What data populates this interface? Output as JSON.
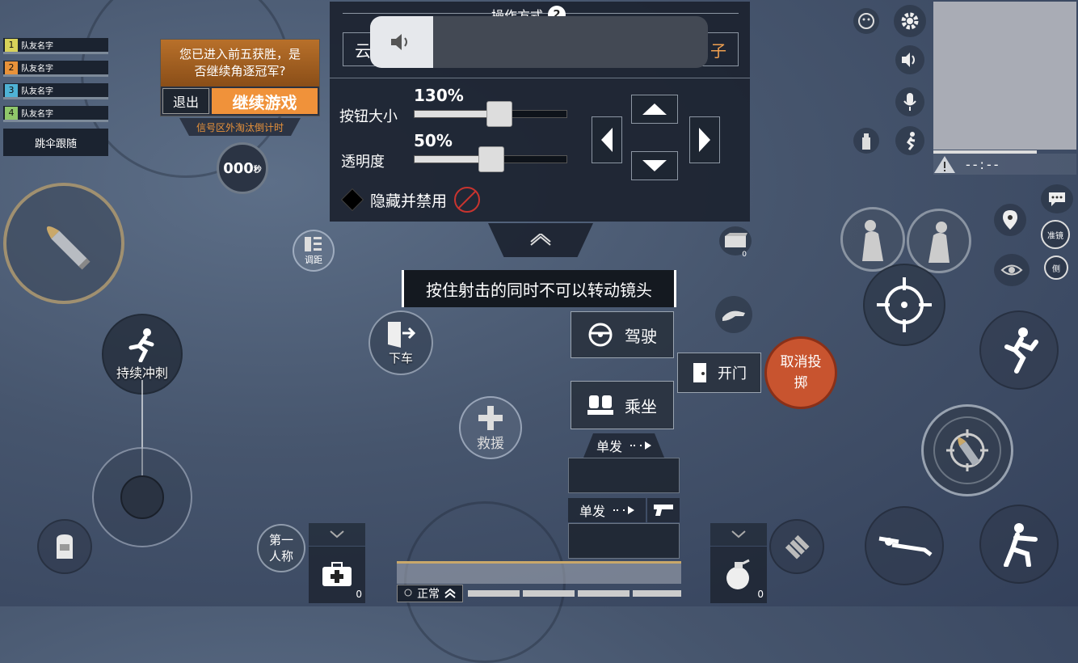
{
  "team": {
    "members": [
      {
        "num": "1",
        "name": "队友名字",
        "color": "#d8d25a"
      },
      {
        "num": "2",
        "name": "队友名字",
        "color": "#e8923a"
      },
      {
        "num": "3",
        "name": "队友名字",
        "color": "#4fb3d6"
      },
      {
        "num": "4",
        "name": "队友名字",
        "color": "#8fc76a"
      }
    ],
    "follow_label": "跳伞跟随"
  },
  "prompt": {
    "message": "您已进入前五获胜，是否继续角逐冠军?",
    "exit_label": "退出",
    "continue_label": "继续游戏",
    "subtitle": "信号区外淘汰倒计时"
  },
  "timer": {
    "digits": "000",
    "unit": "秒"
  },
  "settings_panel": {
    "title": "操作方式",
    "title_badge": "2",
    "mode_left": "云",
    "mode_right": "子",
    "button_size_label": "按钮大小",
    "button_size_value": "130%",
    "button_size_fraction": 0.55,
    "opacity_label": "透明度",
    "opacity_value": "50%",
    "opacity_fraction": 0.5,
    "hide_label": "隐藏并禁用"
  },
  "hint": "按住射击的同时不可以转动镜头",
  "actions": {
    "sprint": "持续冲刺",
    "exit_vehicle": "下车",
    "distance": "调距",
    "drive": "驾驶",
    "ride": "乘坐",
    "open_door": "开门",
    "cancel_throw": "取消投掷",
    "rescue": "救援",
    "first_person": "第一人称",
    "aim": "准镜",
    "side": "侧"
  },
  "weapons": {
    "slot1_mode": "单发",
    "slot2_mode": "单发"
  },
  "inventory": {
    "medkit_count": "0",
    "grenade_count": "0",
    "crate_count": "0"
  },
  "status": {
    "posture": "正常"
  },
  "minimap": {
    "coords": "--:--"
  },
  "colors": {
    "accent_orange": "#f0923a",
    "cancel_red": "#c8542f"
  }
}
